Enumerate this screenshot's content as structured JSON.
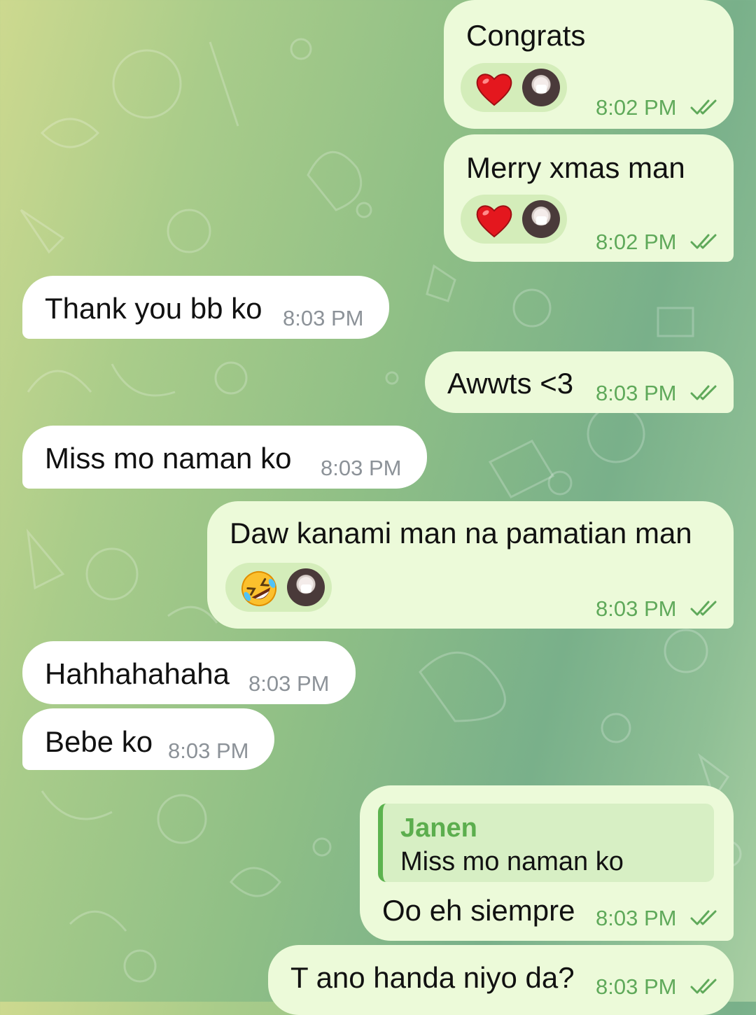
{
  "colors": {
    "outgoing_bubble": "#ecfad9",
    "incoming_bubble": "#ffffff",
    "accent": "#5cae4e"
  },
  "messages": [
    {
      "side": "out",
      "text": "Congrats",
      "time": "8:02 PM",
      "status": "read",
      "reaction": "red-heart"
    },
    {
      "side": "out",
      "text": "Merry xmas man",
      "time": "8:02 PM",
      "status": "read",
      "reaction": "red-heart"
    },
    {
      "side": "in",
      "text": "Thank you bb ko",
      "time": "8:03 PM"
    },
    {
      "side": "out",
      "text": "Awwts <3",
      "time": "8:03 PM",
      "status": "read"
    },
    {
      "side": "in",
      "text": "Miss mo naman ko",
      "time": "8:03 PM"
    },
    {
      "side": "out",
      "text": "Daw kanami man na pamatian man",
      "time": "8:03 PM",
      "status": "read",
      "reaction": "rolling-on-floor-laughing"
    },
    {
      "side": "in",
      "text": "Hahhahahaha",
      "time": "8:03 PM"
    },
    {
      "side": "in",
      "text": "Bebe ko",
      "time": "8:03 PM"
    },
    {
      "side": "out",
      "text": "Oo eh siempre",
      "time": "8:03 PM",
      "status": "read",
      "reply_to": {
        "name": "Janen",
        "text": "Miss mo naman ko"
      }
    },
    {
      "side": "out",
      "text": "T ano handa niyo da?",
      "time": "8:03 PM",
      "status": "read"
    }
  ]
}
